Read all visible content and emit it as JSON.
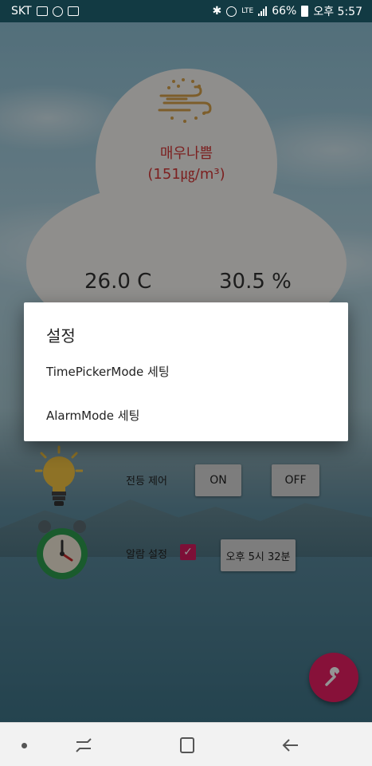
{
  "status_bar": {
    "carrier": "SKT",
    "network": "LTE",
    "battery": "66%",
    "time": "오후 5:57"
  },
  "weather": {
    "air_quality": "매우나쁨",
    "pm_value": "(151㎍/m³)",
    "temperature": "26.0 C",
    "humidity": "30.5 %"
  },
  "controls": {
    "light_label": "전등 제어",
    "on_label": "ON",
    "off_label": "OFF",
    "alarm_label": "알람 설정",
    "alarm_checked": true,
    "alarm_time": "오후 5시 32분"
  },
  "dialog": {
    "title": "설정",
    "items": [
      "TimePickerMode 세팅",
      "AlarmMode 세팅"
    ]
  },
  "colors": {
    "accent": "#e91e63",
    "pm_text": "#d63a3a"
  }
}
